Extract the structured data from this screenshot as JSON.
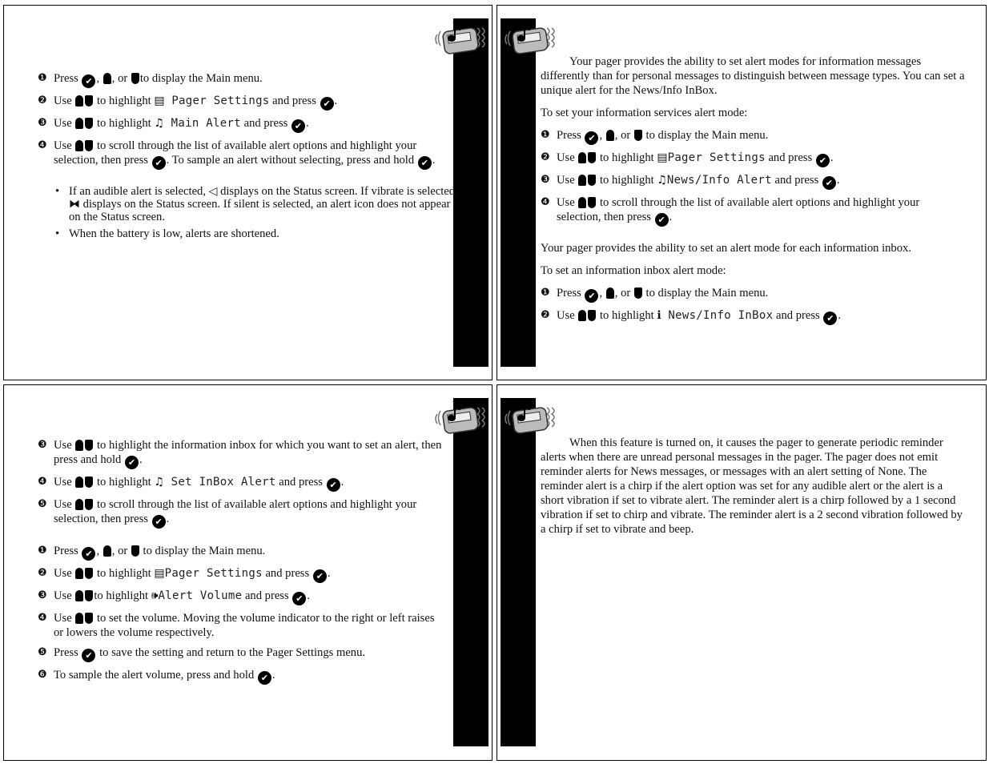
{
  "colors": {
    "bar": "#000000",
    "ink": "#111111"
  },
  "logo": "pager-with-music-note-icon",
  "panel1": {
    "steps": [
      {
        "num": "❶",
        "parts": [
          "Press ",
          {
            "icon": "check"
          },
          ", ",
          {
            "icon": "up"
          },
          ", or ",
          {
            "icon": "down"
          },
          "to display the Main menu."
        ]
      },
      {
        "num": "❷",
        "parts": [
          "Use ",
          {
            "icon": "up"
          },
          {
            "icon": "down"
          },
          " to highlight ",
          {
            "glyph": "▤",
            "name": "pager-settings-icon"
          },
          {
            "lcd": " Pager Settings"
          },
          " and press ",
          {
            "icon": "check"
          },
          "."
        ]
      },
      {
        "num": "❸",
        "parts": [
          "Use ",
          {
            "icon": "up"
          },
          {
            "icon": "down"
          },
          " to highlight ",
          {
            "glyph": "♫",
            "name": "music-note-icon"
          },
          {
            "lcd": " Main Alert"
          },
          " and press ",
          {
            "icon": "check"
          },
          "."
        ]
      },
      {
        "num": "❹",
        "parts": [
          "Use ",
          {
            "icon": "up"
          },
          {
            "icon": "down"
          },
          " to scroll through the list of available alert options and highlight your selection, then press ",
          {
            "icon": "check"
          },
          ". To sample an alert without selecting, press and hold ",
          {
            "icon": "check"
          },
          "."
        ]
      }
    ],
    "bullets": [
      [
        "If an audible alert is selected, ",
        {
          "glyph": "◁",
          "name": "audible-alert-icon"
        },
        " displays on the Status screen. If vibrate is selected, ",
        {
          "glyph": "⧓",
          "name": "vibrate-alert-icon"
        },
        " displays on the Status screen. If silent is selected, an alert icon does not appear on the Status screen."
      ],
      [
        "When the battery is low, alerts are shortened."
      ]
    ]
  },
  "panel2": {
    "intro1": "Your pager provides the ability to set alert modes for information messages differently than for personal messages to distinguish between message types. You can set a unique alert for the News/Info InBox.",
    "lead1": "To set your information services alert mode:",
    "steps1": [
      {
        "num": "❶",
        "parts": [
          "Press ",
          {
            "icon": "check"
          },
          ", ",
          {
            "icon": "up"
          },
          ", or ",
          {
            "icon": "down"
          },
          " to display the Main menu."
        ]
      },
      {
        "num": "❷",
        "parts": [
          "Use ",
          {
            "icon": "up"
          },
          {
            "icon": "down"
          },
          " to highlight ",
          {
            "glyph": "▤",
            "name": "pager-settings-icon"
          },
          {
            "lcd": "Pager Settings"
          },
          " and press ",
          {
            "icon": "check"
          },
          "."
        ]
      },
      {
        "num": "❸",
        "parts": [
          "Use ",
          {
            "icon": "up"
          },
          {
            "icon": "down"
          },
          " to highlight ",
          {
            "glyph": "♫",
            "name": "music-note-icon"
          },
          {
            "lcd": "News/Info Alert"
          },
          " and press ",
          {
            "icon": "check"
          },
          "."
        ]
      },
      {
        "num": "❹",
        "parts": [
          "Use ",
          {
            "icon": "up"
          },
          {
            "icon": "down"
          },
          " to scroll through the list of available alert options and highlight your selection, then press ",
          {
            "icon": "check"
          },
          "."
        ]
      }
    ],
    "intro2": "Your pager provides the ability to set an alert mode for each information inbox.",
    "lead2": "To set an information inbox alert mode:",
    "steps2": [
      {
        "num": "❶",
        "parts": [
          "Press ",
          {
            "icon": "check"
          },
          ", ",
          {
            "icon": "up"
          },
          ", or ",
          {
            "icon": "down"
          },
          " to display the Main menu."
        ]
      },
      {
        "num": "❷",
        "parts": [
          "Use ",
          {
            "icon": "up"
          },
          {
            "icon": "down"
          },
          " to highlight ",
          {
            "glyph": "ℹ",
            "name": "info-icon"
          },
          {
            "lcd": " News/Info InBox"
          },
          " and press ",
          {
            "icon": "check"
          },
          "."
        ]
      }
    ]
  },
  "panel3": {
    "steps1": [
      {
        "num": "❸",
        "parts": [
          "Use ",
          {
            "icon": "up"
          },
          {
            "icon": "down"
          },
          " to highlight the information inbox for which you want to set an alert, then press and hold ",
          {
            "icon": "check"
          },
          "."
        ]
      },
      {
        "num": "❹",
        "parts": [
          "Use ",
          {
            "icon": "up"
          },
          {
            "icon": "down"
          },
          " to highlight ",
          {
            "glyph": "♫",
            "name": "music-note-icon"
          },
          {
            "lcd": " Set InBox Alert"
          },
          " and press ",
          {
            "icon": "check"
          },
          "."
        ]
      },
      {
        "num": "❺",
        "parts": [
          "Use ",
          {
            "icon": "up"
          },
          {
            "icon": "down"
          },
          " to scroll through the list of available alert options and highlight your selection, then press ",
          {
            "icon": "check"
          },
          "."
        ]
      }
    ],
    "steps2": [
      {
        "num": "❶",
        "parts": [
          "Press ",
          {
            "icon": "check"
          },
          ", ",
          {
            "icon": "up"
          },
          ", or ",
          {
            "icon": "down"
          },
          " to display the Main menu."
        ]
      },
      {
        "num": "❷",
        "parts": [
          "Use ",
          {
            "icon": "up"
          },
          {
            "icon": "down"
          },
          " to highlight ",
          {
            "glyph": "▤",
            "name": "pager-settings-icon"
          },
          {
            "lcd": "Pager Settings"
          },
          " and press ",
          {
            "icon": "check"
          },
          "."
        ]
      },
      {
        "num": "❸",
        "parts": [
          "Use ",
          {
            "icon": "up"
          },
          {
            "icon": "down"
          },
          "to highlight ",
          {
            "glyph": "🕪",
            "name": "speaker-icon"
          },
          {
            "lcd": "Alert Volume"
          },
          " and press ",
          {
            "icon": "check"
          },
          "."
        ]
      },
      {
        "num": "❹",
        "parts": [
          "Use ",
          {
            "icon": "up"
          },
          {
            "icon": "down"
          },
          " to set the volume. Moving the volume indicator to the right or left raises or lowers the volume respectively."
        ]
      },
      {
        "num": "❺",
        "parts": [
          "Press ",
          {
            "icon": "check"
          },
          " to save the setting and return to the Pager Settings menu."
        ]
      },
      {
        "num": "❻",
        "parts": [
          "To sample the alert volume, press and hold ",
          {
            "icon": "check"
          },
          "."
        ]
      }
    ]
  },
  "panel4": {
    "text": "When this feature is turned on, it causes the pager to generate periodic reminder alerts when there are unread personal messages in the pager. The pager does not emit reminder alerts for News messages, or messages with an alert setting of None. The reminder alert is a chirp if the alert option was set for any audible alert or the alert is a short vibration if set to vibrate alert. The reminder alert is a chirp followed by a 1 second vibration if set to chirp and vibrate. The reminder alert is a 2 second vibration followed by a chirp if set to vibrate and beep."
  }
}
